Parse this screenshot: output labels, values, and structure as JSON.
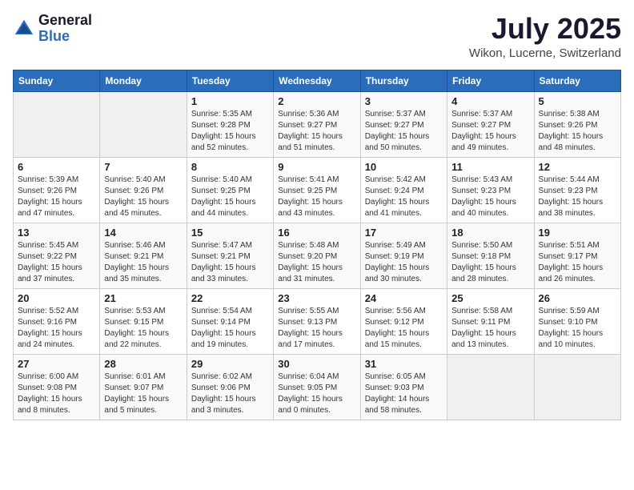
{
  "logo": {
    "general": "General",
    "blue": "Blue"
  },
  "title": "July 2025",
  "location": "Wikon, Lucerne, Switzerland",
  "days_of_week": [
    "Sunday",
    "Monday",
    "Tuesday",
    "Wednesday",
    "Thursday",
    "Friday",
    "Saturday"
  ],
  "weeks": [
    [
      {
        "day": "",
        "info": ""
      },
      {
        "day": "",
        "info": ""
      },
      {
        "day": "1",
        "info": "Sunrise: 5:35 AM\nSunset: 9:28 PM\nDaylight: 15 hours\nand 52 minutes."
      },
      {
        "day": "2",
        "info": "Sunrise: 5:36 AM\nSunset: 9:27 PM\nDaylight: 15 hours\nand 51 minutes."
      },
      {
        "day": "3",
        "info": "Sunrise: 5:37 AM\nSunset: 9:27 PM\nDaylight: 15 hours\nand 50 minutes."
      },
      {
        "day": "4",
        "info": "Sunrise: 5:37 AM\nSunset: 9:27 PM\nDaylight: 15 hours\nand 49 minutes."
      },
      {
        "day": "5",
        "info": "Sunrise: 5:38 AM\nSunset: 9:26 PM\nDaylight: 15 hours\nand 48 minutes."
      }
    ],
    [
      {
        "day": "6",
        "info": "Sunrise: 5:39 AM\nSunset: 9:26 PM\nDaylight: 15 hours\nand 47 minutes."
      },
      {
        "day": "7",
        "info": "Sunrise: 5:40 AM\nSunset: 9:26 PM\nDaylight: 15 hours\nand 45 minutes."
      },
      {
        "day": "8",
        "info": "Sunrise: 5:40 AM\nSunset: 9:25 PM\nDaylight: 15 hours\nand 44 minutes."
      },
      {
        "day": "9",
        "info": "Sunrise: 5:41 AM\nSunset: 9:25 PM\nDaylight: 15 hours\nand 43 minutes."
      },
      {
        "day": "10",
        "info": "Sunrise: 5:42 AM\nSunset: 9:24 PM\nDaylight: 15 hours\nand 41 minutes."
      },
      {
        "day": "11",
        "info": "Sunrise: 5:43 AM\nSunset: 9:23 PM\nDaylight: 15 hours\nand 40 minutes."
      },
      {
        "day": "12",
        "info": "Sunrise: 5:44 AM\nSunset: 9:23 PM\nDaylight: 15 hours\nand 38 minutes."
      }
    ],
    [
      {
        "day": "13",
        "info": "Sunrise: 5:45 AM\nSunset: 9:22 PM\nDaylight: 15 hours\nand 37 minutes."
      },
      {
        "day": "14",
        "info": "Sunrise: 5:46 AM\nSunset: 9:21 PM\nDaylight: 15 hours\nand 35 minutes."
      },
      {
        "day": "15",
        "info": "Sunrise: 5:47 AM\nSunset: 9:21 PM\nDaylight: 15 hours\nand 33 minutes."
      },
      {
        "day": "16",
        "info": "Sunrise: 5:48 AM\nSunset: 9:20 PM\nDaylight: 15 hours\nand 31 minutes."
      },
      {
        "day": "17",
        "info": "Sunrise: 5:49 AM\nSunset: 9:19 PM\nDaylight: 15 hours\nand 30 minutes."
      },
      {
        "day": "18",
        "info": "Sunrise: 5:50 AM\nSunset: 9:18 PM\nDaylight: 15 hours\nand 28 minutes."
      },
      {
        "day": "19",
        "info": "Sunrise: 5:51 AM\nSunset: 9:17 PM\nDaylight: 15 hours\nand 26 minutes."
      }
    ],
    [
      {
        "day": "20",
        "info": "Sunrise: 5:52 AM\nSunset: 9:16 PM\nDaylight: 15 hours\nand 24 minutes."
      },
      {
        "day": "21",
        "info": "Sunrise: 5:53 AM\nSunset: 9:15 PM\nDaylight: 15 hours\nand 22 minutes."
      },
      {
        "day": "22",
        "info": "Sunrise: 5:54 AM\nSunset: 9:14 PM\nDaylight: 15 hours\nand 19 minutes."
      },
      {
        "day": "23",
        "info": "Sunrise: 5:55 AM\nSunset: 9:13 PM\nDaylight: 15 hours\nand 17 minutes."
      },
      {
        "day": "24",
        "info": "Sunrise: 5:56 AM\nSunset: 9:12 PM\nDaylight: 15 hours\nand 15 minutes."
      },
      {
        "day": "25",
        "info": "Sunrise: 5:58 AM\nSunset: 9:11 PM\nDaylight: 15 hours\nand 13 minutes."
      },
      {
        "day": "26",
        "info": "Sunrise: 5:59 AM\nSunset: 9:10 PM\nDaylight: 15 hours\nand 10 minutes."
      }
    ],
    [
      {
        "day": "27",
        "info": "Sunrise: 6:00 AM\nSunset: 9:08 PM\nDaylight: 15 hours\nand 8 minutes."
      },
      {
        "day": "28",
        "info": "Sunrise: 6:01 AM\nSunset: 9:07 PM\nDaylight: 15 hours\nand 5 minutes."
      },
      {
        "day": "29",
        "info": "Sunrise: 6:02 AM\nSunset: 9:06 PM\nDaylight: 15 hours\nand 3 minutes."
      },
      {
        "day": "30",
        "info": "Sunrise: 6:04 AM\nSunset: 9:05 PM\nDaylight: 15 hours\nand 0 minutes."
      },
      {
        "day": "31",
        "info": "Sunrise: 6:05 AM\nSunset: 9:03 PM\nDaylight: 14 hours\nand 58 minutes."
      },
      {
        "day": "",
        "info": ""
      },
      {
        "day": "",
        "info": ""
      }
    ]
  ]
}
